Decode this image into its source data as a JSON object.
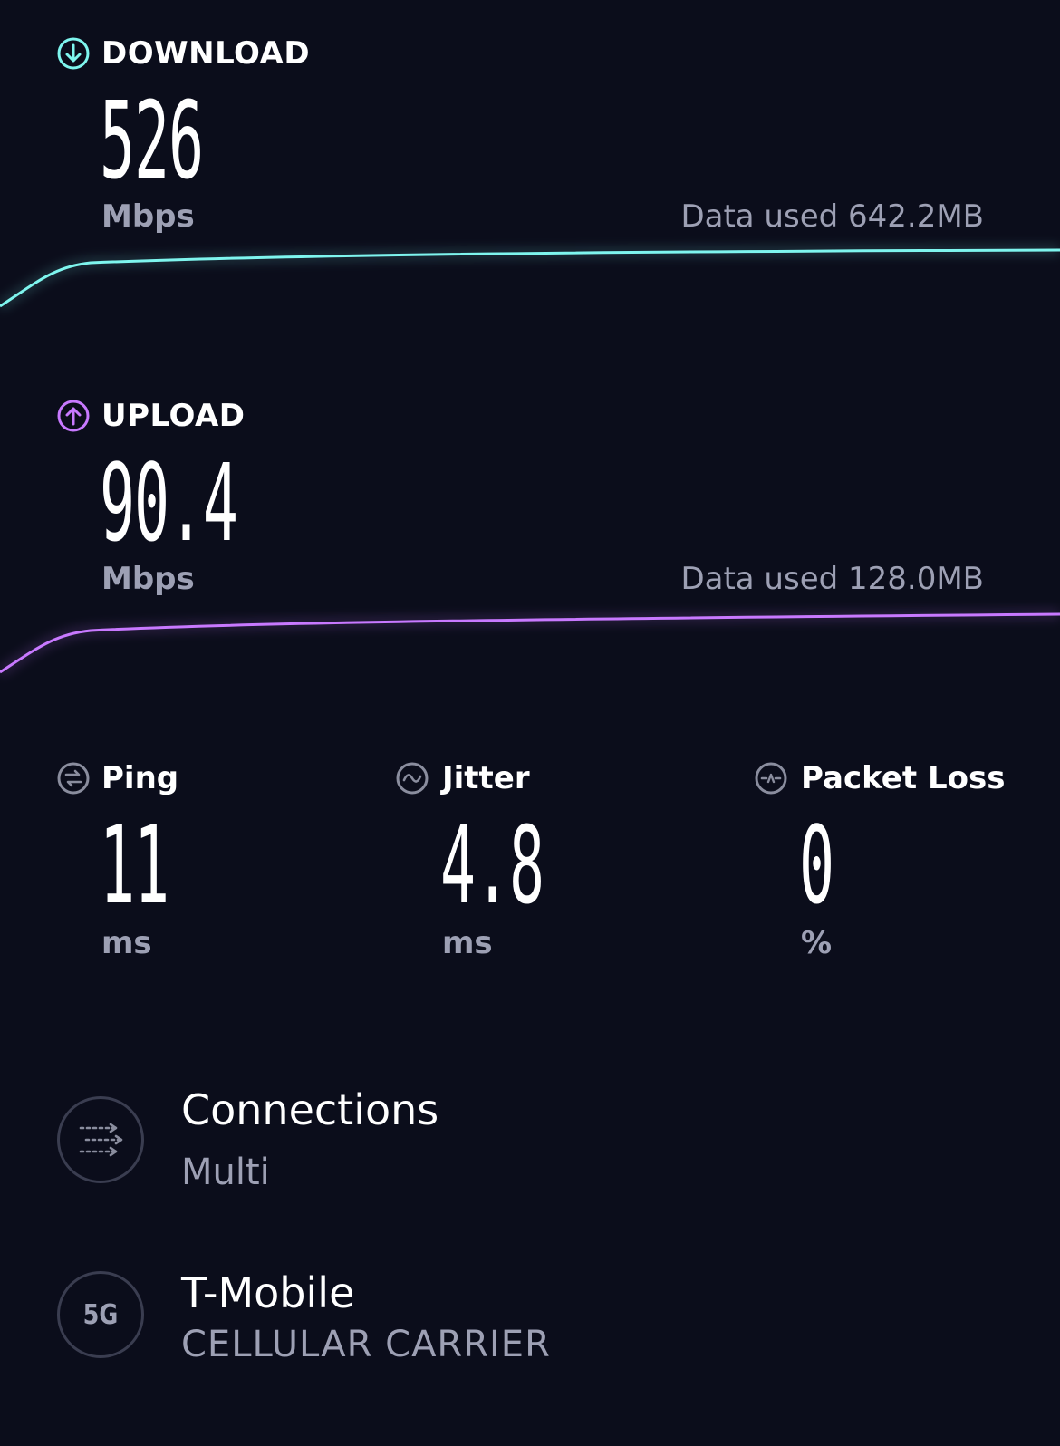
{
  "download": {
    "label": "DOWNLOAD",
    "value": "526",
    "unit": "Mbps",
    "data_used": "Data used 642.2MB",
    "color": "#7ef5ee"
  },
  "upload": {
    "label": "UPLOAD",
    "value": "90.4",
    "unit": "Mbps",
    "data_used": "Data used 128.0MB",
    "color": "#c879ff"
  },
  "metrics": [
    {
      "label": "Ping",
      "value": "11",
      "unit": "ms",
      "icon": "ping-icon"
    },
    {
      "label": "Jitter",
      "value": "4.8",
      "unit": "ms",
      "icon": "jitter-icon"
    },
    {
      "label": "Packet Loss",
      "value": "0",
      "unit": "%",
      "icon": "packet-loss-icon"
    }
  ],
  "connections": {
    "title": "Connections",
    "value": "Multi",
    "icon": "connections-icon"
  },
  "carrier": {
    "badge": "5G",
    "title": "T-Mobile",
    "subtitle": "CELLULAR CARRIER",
    "icon": "5g-icon"
  },
  "colors": {
    "background": "#0b0d1b",
    "muted_text": "#9da0b4",
    "icon_gray": "#8a8d9e"
  }
}
